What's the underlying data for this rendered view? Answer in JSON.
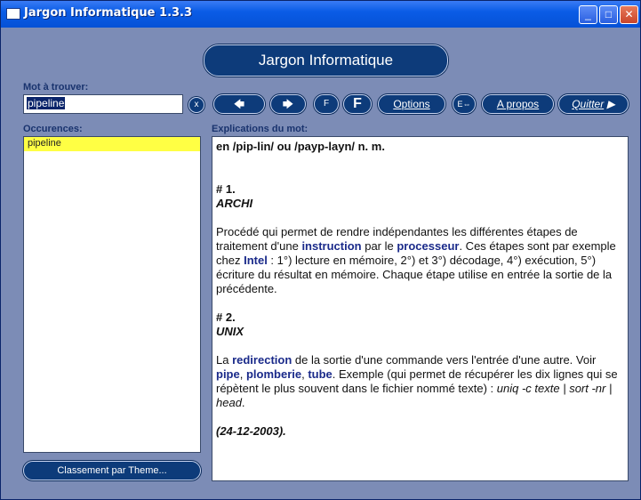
{
  "window": {
    "title": "Jargon Informatique 1.3.3",
    "controls": {
      "minimize": "_",
      "maximize": "□",
      "close": "✕"
    }
  },
  "banner": "Jargon Informatique",
  "search": {
    "label": "Mot à trouver:",
    "value": "pipeline",
    "clear_label": "x"
  },
  "toolbar": {
    "back": "🡄",
    "forward": "🡆",
    "font_small": "F",
    "font_large": "F",
    "options": "Options",
    "eq": "E⇔",
    "apropos": "A propos",
    "quitter": "Quitter"
  },
  "occurrences": {
    "label": "Occurences:",
    "items": [
      "pipeline"
    ]
  },
  "explanation": {
    "label": "Explications du mot:",
    "pron": "en /pip-lin/ ou /payp-layn/ n. m.",
    "sec1": "# 1.",
    "sec1_domain": "ARCHI",
    "p1_a": "Procédé qui permet de rendre indépendantes les différentes étapes de traitement d'une ",
    "p1_kw1": "instruction",
    "p1_b": " par le ",
    "p1_kw2": "processeur",
    "p1_c": ". Ces étapes sont par exemple chez ",
    "p1_kw3": "Intel",
    "p1_d": " : 1°) lecture en mémoire, 2°) et 3°) décodage, 4°) exécution, 5°) écriture du résultat en mémoire. Chaque étape utilise en entrée la sortie de la précédente.",
    "sec2": "# 2.",
    "sec2_domain": "UNIX",
    "p2_a": "La ",
    "p2_kw1": "redirection",
    "p2_b": " de la sortie d'une commande vers l'entrée d'une autre. Voir ",
    "p2_kw2": "pipe",
    "p2_sep1": ", ",
    "p2_kw3": "plomberie",
    "p2_sep2": ", ",
    "p2_kw4": "tube",
    "p2_c": ". Exemple (qui permet de récupérer les dix lignes qui se répètent le plus souvent dans le fichier nommé texte) : ",
    "p2_code": "uniq -c texte | sort -nr | head",
    "p2_end": ".",
    "date": "(24-12-2003)."
  },
  "bottom_button": "Classement par Theme..."
}
